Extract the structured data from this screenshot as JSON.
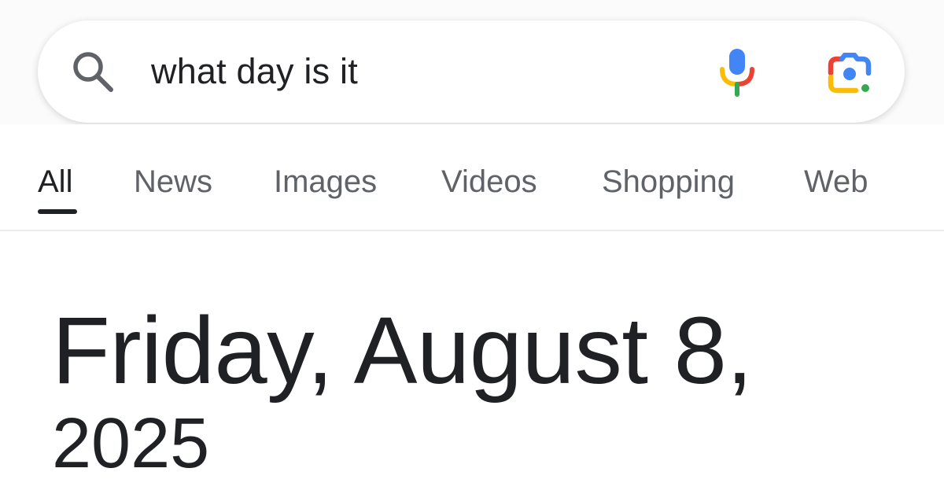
{
  "search": {
    "query": "what day is it",
    "icons": {
      "search": "search-icon",
      "voice": "microphone-icon",
      "lens": "google-lens-icon"
    }
  },
  "tabs": [
    {
      "label": "All",
      "active": true
    },
    {
      "label": "News",
      "active": false
    },
    {
      "label": "Images",
      "active": false
    },
    {
      "label": "Videos",
      "active": false
    },
    {
      "label": "Shopping",
      "active": false
    },
    {
      "label": "Web",
      "active": false
    }
  ],
  "result": {
    "date_line": "Friday, August 8,",
    "year_line": "2025"
  },
  "colors": {
    "google_blue": "#4285F4",
    "google_red": "#EA4335",
    "google_yellow": "#FBBC05",
    "google_green": "#34A853",
    "text_primary": "#202124",
    "text_secondary": "#5f6368"
  }
}
